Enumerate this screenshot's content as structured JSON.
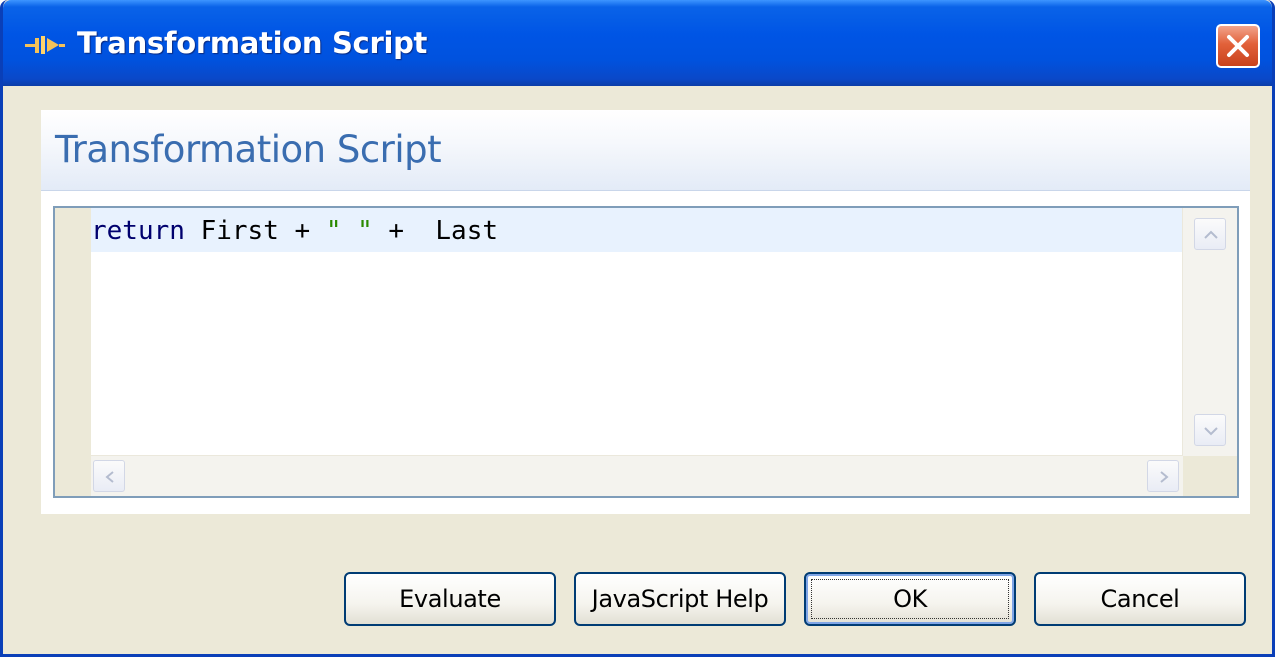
{
  "window": {
    "title": "Transformation Script",
    "icon": "transformation-icon"
  },
  "panel": {
    "title": "Transformation Script"
  },
  "editor": {
    "line_1": {
      "keyword": "return",
      "text_1": " First + ",
      "string": "\" \"",
      "text_2": " +  Last"
    }
  },
  "buttons": {
    "evaluate": "Evaluate",
    "javascript_help": "JavaScript Help",
    "ok": "OK",
    "cancel": "Cancel"
  },
  "colors": {
    "title_bar": "#0055e5",
    "panel_title": "#3a6db0",
    "keyword": "#00006e",
    "string": "#2a8a00",
    "current_line": "#e8f2fe"
  }
}
